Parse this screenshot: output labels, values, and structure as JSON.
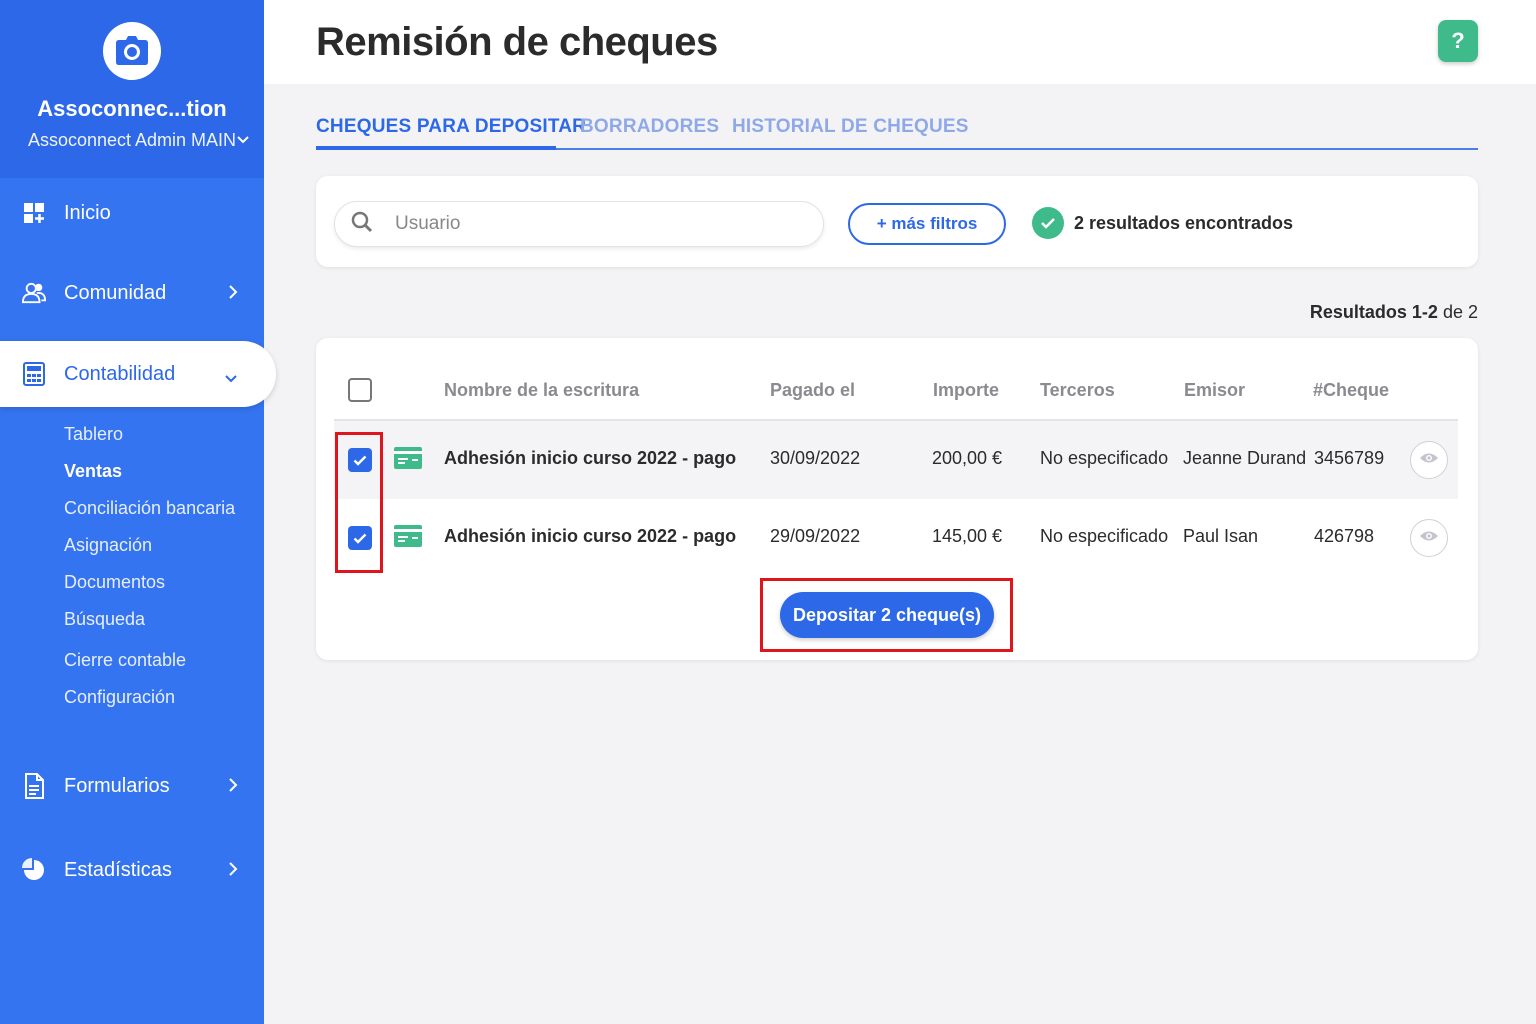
{
  "sidebar": {
    "org_name": "Assoconnec...tion",
    "org_sub": "Assoconnect Admin MAIN",
    "nav": {
      "inicio": "Inicio",
      "comunidad": "Comunidad",
      "contabilidad": "Contabilidad",
      "formularios": "Formularios",
      "estadisticas": "Estadísticas"
    },
    "sub_items": [
      "Tablero",
      "Ventas",
      "Conciliación bancaria",
      "Asignación",
      "Documentos",
      "Búsqueda",
      "Cierre contable",
      "Configuración"
    ],
    "current_sub": "Ventas"
  },
  "header": {
    "title": "Remisión de cheques",
    "help": "?"
  },
  "tabs": [
    "CHEQUES PARA DEPOSITAR",
    "BORRADORES",
    "HISTORIAL DE CHEQUES"
  ],
  "filters": {
    "search_placeholder": "Usuario",
    "more_filters": "+ más filtros",
    "results_found": "2 resultados encontrados"
  },
  "range": {
    "label": "Resultados 1-2",
    "of": "de 2"
  },
  "table": {
    "columns": [
      "Nombre de la escritura",
      "Pagado el",
      "Importe",
      "Terceros",
      "Emisor",
      "#Cheque"
    ],
    "rows": [
      {
        "name": "Adhesión inicio curso 2022 - pago",
        "paid": "30/09/2022",
        "amount": "200,00 €",
        "third": "No especificado",
        "issuer": "Jeanne Durand",
        "cheque": "3456789",
        "checked": true
      },
      {
        "name": "Adhesión inicio curso 2022 - pago",
        "paid": "29/09/2022",
        "amount": "145,00 €",
        "third": "No especificado",
        "issuer": "Paul Isan",
        "cheque": "426798",
        "checked": true
      }
    ],
    "deposit_label": "Depositar 2 cheque(s)"
  },
  "colors": {
    "primary": "#2d68e8",
    "sidebar": "#3574f0",
    "success": "#3fba8a",
    "highlight": "#e0141c"
  }
}
